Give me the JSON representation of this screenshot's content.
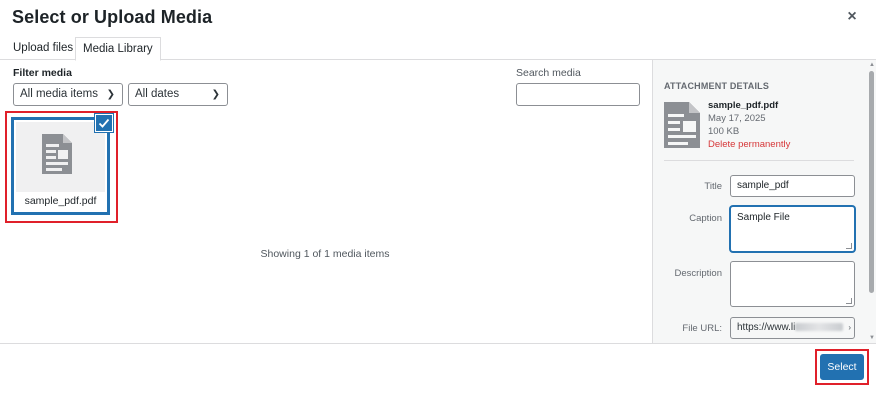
{
  "modal": {
    "title": "Select or Upload Media",
    "close": "×"
  },
  "tabs": [
    {
      "label": "Upload files"
    },
    {
      "label": "Media Library"
    }
  ],
  "filters": {
    "label": "Filter media",
    "type_selected": "All media items",
    "date_selected": "All dates",
    "search_label": "Search media",
    "search_value": ""
  },
  "grid": {
    "items": [
      {
        "filename": "sample_pdf.pdf",
        "selected": true,
        "icon": "document-icon"
      }
    ],
    "status": "Showing 1 of 1 media items"
  },
  "details": {
    "heading": "ATTACHMENT DETAILS",
    "filename": "sample_pdf.pdf",
    "date": "May 17, 2025",
    "size": "100 KB",
    "delete_label": "Delete permanently",
    "fields": {
      "title": {
        "label": "Title",
        "value": "sample_pdf"
      },
      "caption": {
        "label": "Caption",
        "value": "Sample File"
      },
      "description": {
        "label": "Description",
        "value": ""
      },
      "file_url": {
        "label": "File URL:",
        "value": "https://www.li"
      }
    }
  },
  "footer": {
    "select_label": "Select"
  },
  "colors": {
    "accent": "#2271b1",
    "danger": "#d63638",
    "highlight": "#e0202a"
  }
}
